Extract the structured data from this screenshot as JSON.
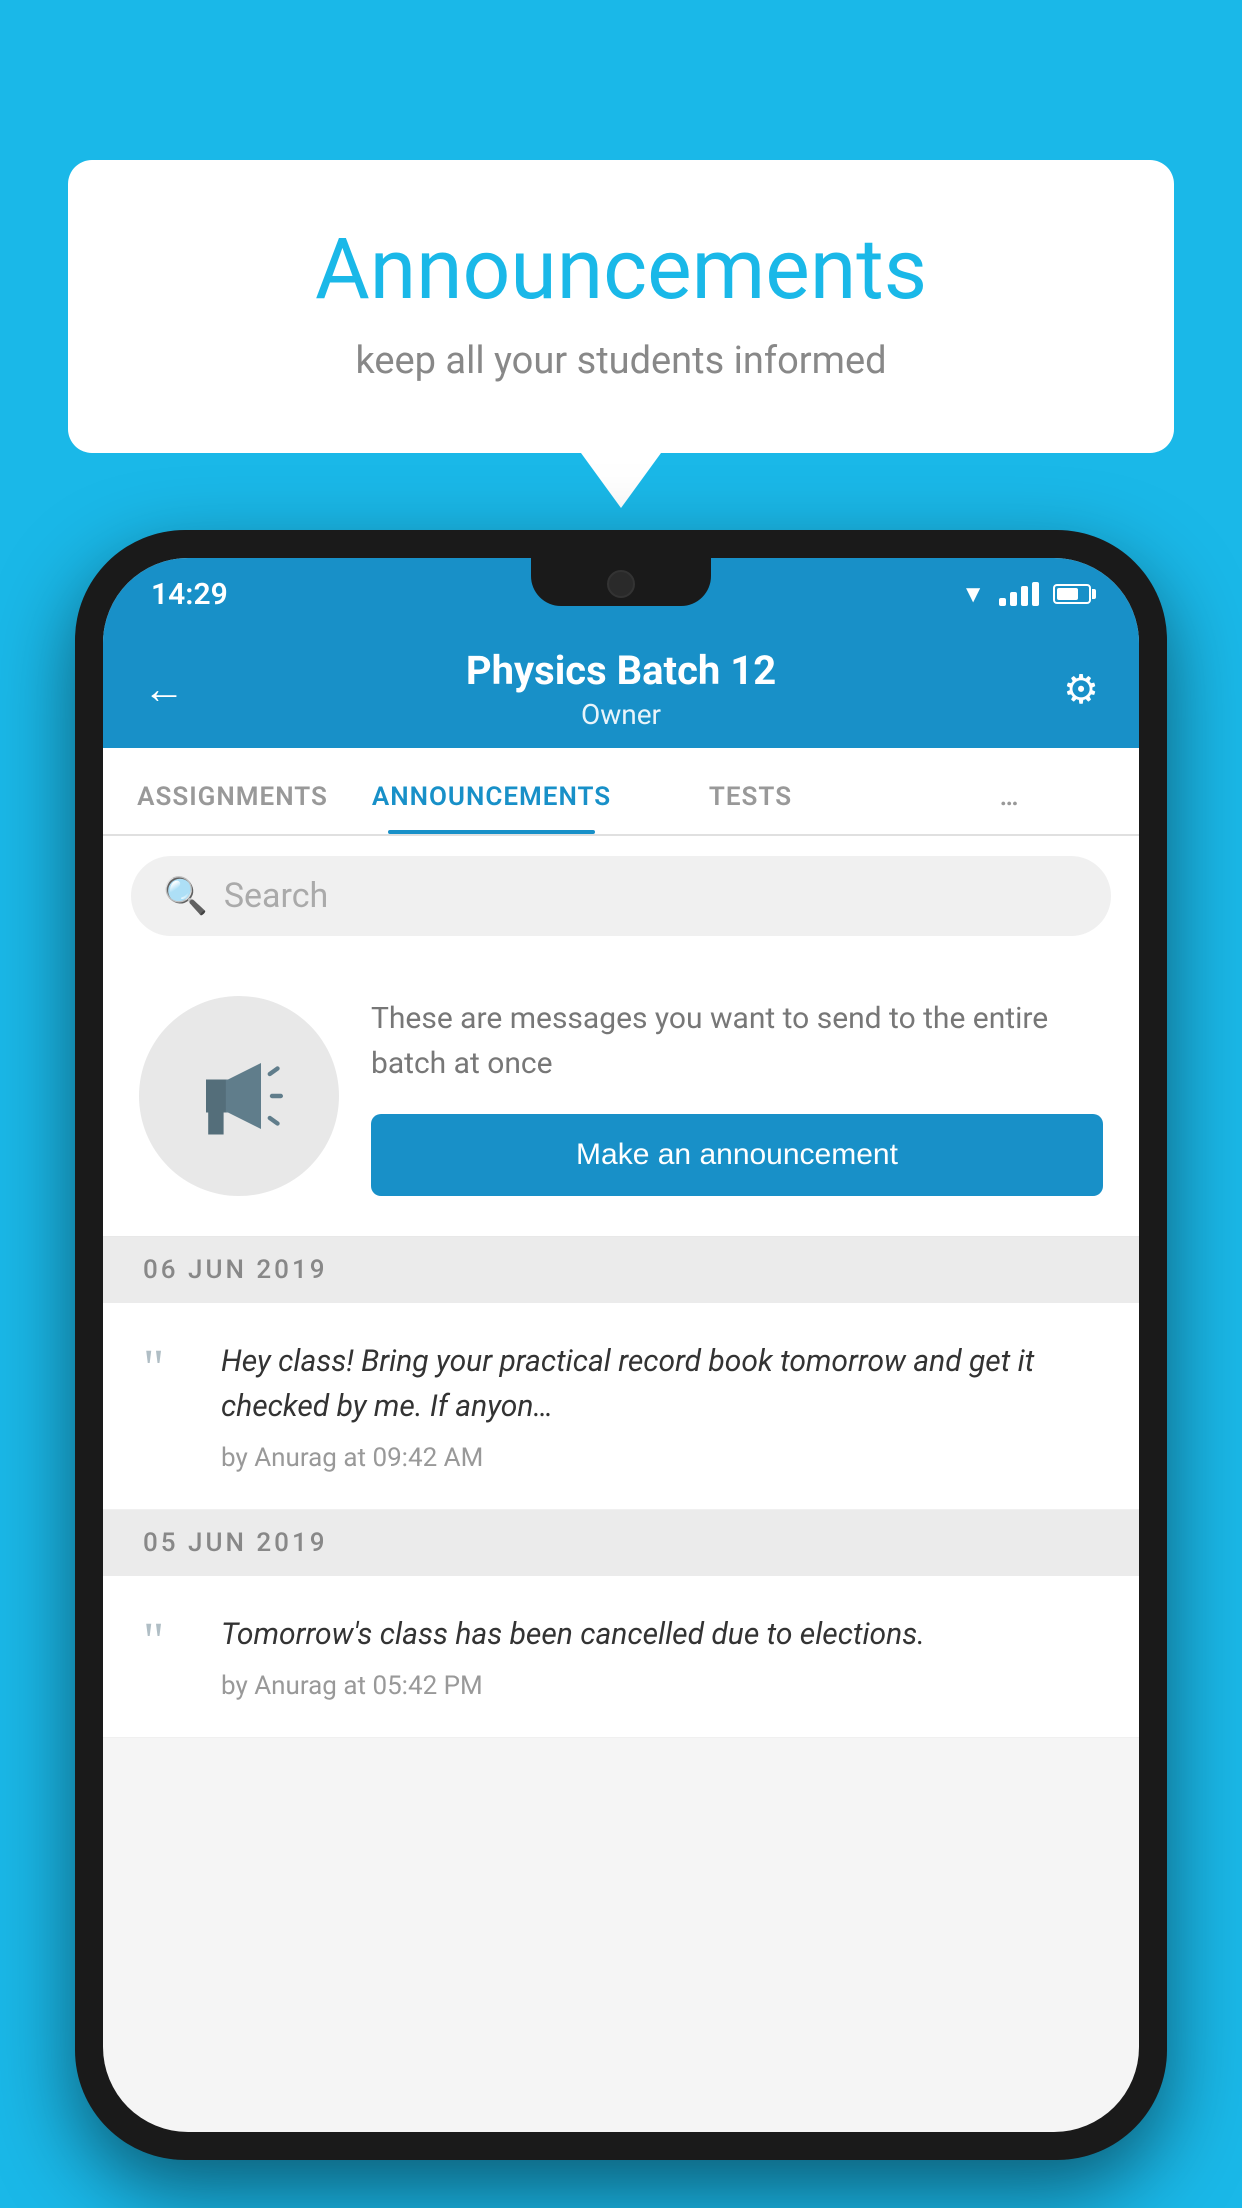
{
  "background": {
    "color": "#1ab8e8"
  },
  "speech_bubble": {
    "title": "Announcements",
    "subtitle": "keep all your students informed"
  },
  "status_bar": {
    "time": "14:29",
    "wifi": "▼",
    "signal": "▲",
    "battery": ""
  },
  "app_header": {
    "back_label": "←",
    "title": "Physics Batch 12",
    "subtitle": "Owner",
    "gear_label": "⚙"
  },
  "tabs": [
    {
      "label": "ASSIGNMENTS",
      "active": false
    },
    {
      "label": "ANNOUNCEMENTS",
      "active": true
    },
    {
      "label": "TESTS",
      "active": false
    },
    {
      "label": "…",
      "active": false
    }
  ],
  "search": {
    "placeholder": "Search",
    "icon": "🔍"
  },
  "announcement_promo": {
    "description_text": "These are messages you want to send to the entire batch at once",
    "button_label": "Make an announcement"
  },
  "announcements": [
    {
      "date_label": "06  JUN  2019",
      "message": "Hey class! Bring your practical record book tomorrow and get it checked by me. If anyon…",
      "meta": "by Anurag at 09:42 AM"
    },
    {
      "date_label": "05  JUN  2019",
      "message": "Tomorrow's class has been cancelled due to elections.",
      "meta": "by Anurag at 05:42 PM"
    }
  ]
}
